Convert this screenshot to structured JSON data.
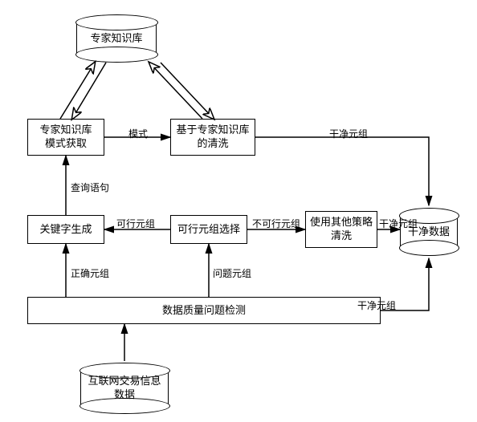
{
  "nodes": {
    "expert_kb": "专家知识库",
    "pattern_acq": "专家知识库\n模式获取",
    "kb_clean": "基于专家知识库\n的清洗",
    "keyword_gen": "关键字生成",
    "feasible_sel": "可行元组选择",
    "other_clean": "使用其他策略\n清洗",
    "clean_data": "干净数据",
    "quality_detect": "数据质量问题检测",
    "internet_data": "互联网交易信息\n数据"
  },
  "edges": {
    "pattern": "模式",
    "query": "查询语句",
    "feasible": "可行元组",
    "infeasible": "不可行元组",
    "clean_tuple_1": "干净元组",
    "clean_tuple_2": "干净元组",
    "clean_tuple_3": "干净元组",
    "correct": "正确元组",
    "problem": "问题元组"
  }
}
